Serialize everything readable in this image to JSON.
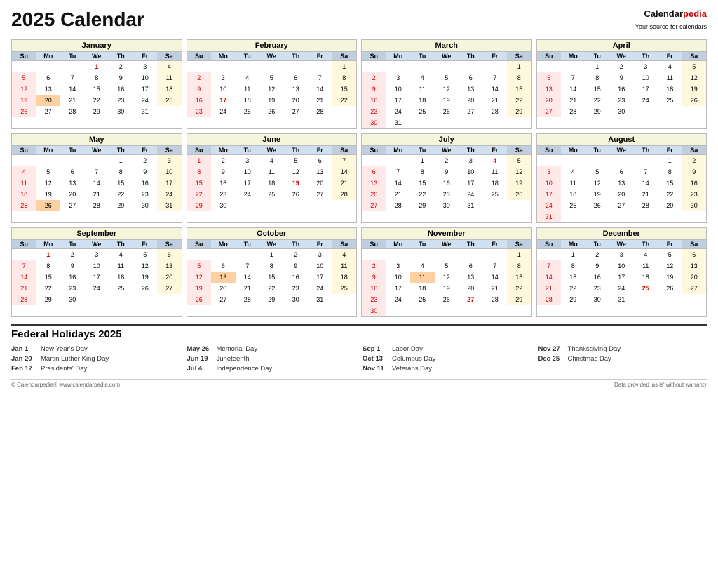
{
  "header": {
    "title": "2025 Calendar",
    "brand_name": "Calendar",
    "brand_suffix": "pedia",
    "brand_sub": "Your source for calendars"
  },
  "months": [
    {
      "name": "January",
      "days": [
        [
          "",
          "",
          "1",
          "2",
          "3",
          "4"
        ],
        [
          "5",
          "6",
          "7",
          "8",
          "9",
          "10",
          "11"
        ],
        [
          "12",
          "13",
          "14",
          "15",
          "16",
          "17",
          "18"
        ],
        [
          "19",
          "20",
          "21",
          "22",
          "23",
          "24",
          "25"
        ],
        [
          "26",
          "27",
          "28",
          "29",
          "30",
          "31",
          ""
        ]
      ],
      "holidays": {
        "1": "red",
        "20": "orange"
      }
    },
    {
      "name": "February",
      "days": [
        [
          "",
          "",
          "",
          "",
          "",
          "",
          "1"
        ],
        [
          "2",
          "3",
          "4",
          "5",
          "6",
          "7",
          "8"
        ],
        [
          "9",
          "10",
          "11",
          "12",
          "13",
          "14",
          "15"
        ],
        [
          "16",
          "17",
          "18",
          "19",
          "20",
          "21",
          "22"
        ],
        [
          "23",
          "24",
          "25",
          "26",
          "27",
          "28",
          ""
        ]
      ],
      "holidays": {
        "17": "red"
      }
    },
    {
      "name": "March",
      "days": [
        [
          "",
          "",
          "",
          "",
          "",
          "",
          "1"
        ],
        [
          "2",
          "3",
          "4",
          "5",
          "6",
          "7",
          "8"
        ],
        [
          "9",
          "10",
          "11",
          "12",
          "13",
          "14",
          "15"
        ],
        [
          "16",
          "17",
          "18",
          "19",
          "20",
          "21",
          "22"
        ],
        [
          "23",
          "24",
          "25",
          "26",
          "27",
          "28",
          "29"
        ],
        [
          "30",
          "31",
          "",
          "",
          "",
          "",
          ""
        ]
      ],
      "holidays": {}
    },
    {
      "name": "April",
      "days": [
        [
          "",
          "1",
          "2",
          "3",
          "4",
          "5"
        ],
        [
          "6",
          "7",
          "8",
          "9",
          "10",
          "11",
          "12"
        ],
        [
          "13",
          "14",
          "15",
          "16",
          "17",
          "18",
          "19"
        ],
        [
          "20",
          "21",
          "22",
          "23",
          "24",
          "25",
          "26"
        ],
        [
          "27",
          "28",
          "29",
          "30",
          "",
          "",
          ""
        ]
      ],
      "holidays": {}
    },
    {
      "name": "May",
      "days": [
        [
          "",
          "",
          "",
          "1",
          "2",
          "3"
        ],
        [
          "4",
          "5",
          "6",
          "7",
          "8",
          "9",
          "10"
        ],
        [
          "11",
          "12",
          "13",
          "14",
          "15",
          "16",
          "17"
        ],
        [
          "18",
          "19",
          "20",
          "21",
          "22",
          "23",
          "24"
        ],
        [
          "25",
          "26",
          "27",
          "28",
          "29",
          "30",
          "31"
        ]
      ],
      "holidays": {
        "26": "orange"
      }
    },
    {
      "name": "June",
      "days": [
        [
          "1",
          "2",
          "3",
          "4",
          "5",
          "6",
          "7"
        ],
        [
          "8",
          "9",
          "10",
          "11",
          "12",
          "13",
          "14"
        ],
        [
          "15",
          "16",
          "17",
          "18",
          "19",
          "20",
          "21"
        ],
        [
          "22",
          "23",
          "24",
          "25",
          "26",
          "27",
          "28"
        ],
        [
          "29",
          "30",
          "",
          "",
          "",
          "",
          ""
        ]
      ],
      "holidays": {
        "19": "red"
      }
    },
    {
      "name": "July",
      "days": [
        [
          "",
          "",
          "1",
          "2",
          "3",
          "4",
          "5"
        ],
        [
          "6",
          "7",
          "8",
          "9",
          "10",
          "11",
          "12"
        ],
        [
          "13",
          "14",
          "15",
          "16",
          "17",
          "18",
          "19"
        ],
        [
          "20",
          "21",
          "22",
          "23",
          "24",
          "25",
          "26"
        ],
        [
          "27",
          "28",
          "29",
          "30",
          "31",
          "",
          ""
        ]
      ],
      "holidays": {
        "4": "red"
      }
    },
    {
      "name": "August",
      "days": [
        [
          "",
          "",
          "",
          "",
          "",
          "1",
          "2"
        ],
        [
          "3",
          "4",
          "5",
          "6",
          "7",
          "8",
          "9"
        ],
        [
          "10",
          "11",
          "12",
          "13",
          "14",
          "15",
          "16"
        ],
        [
          "17",
          "18",
          "19",
          "20",
          "21",
          "22",
          "23"
        ],
        [
          "24",
          "25",
          "26",
          "27",
          "28",
          "29",
          "30"
        ],
        [
          "31",
          "",
          "",
          "",
          "",
          "",
          ""
        ]
      ],
      "holidays": {}
    },
    {
      "name": "September",
      "days": [
        [
          "",
          "1",
          "2",
          "3",
          "4",
          "5",
          "6"
        ],
        [
          "7",
          "8",
          "9",
          "10",
          "11",
          "12",
          "13"
        ],
        [
          "14",
          "15",
          "16",
          "17",
          "18",
          "19",
          "20"
        ],
        [
          "21",
          "22",
          "23",
          "24",
          "25",
          "26",
          "27"
        ],
        [
          "28",
          "29",
          "30",
          "",
          "",
          "",
          ""
        ]
      ],
      "holidays": {
        "1": "red"
      }
    },
    {
      "name": "October",
      "days": [
        [
          "",
          "",
          "1",
          "2",
          "3",
          "4"
        ],
        [
          "5",
          "6",
          "7",
          "8",
          "9",
          "10",
          "11"
        ],
        [
          "12",
          "13",
          "14",
          "15",
          "16",
          "17",
          "18"
        ],
        [
          "19",
          "20",
          "21",
          "22",
          "23",
          "24",
          "25"
        ],
        [
          "26",
          "27",
          "28",
          "29",
          "30",
          "31",
          ""
        ]
      ],
      "holidays": {
        "13": "orange"
      }
    },
    {
      "name": "November",
      "days": [
        [
          "",
          "",
          "",
          "",
          "",
          "",
          "1"
        ],
        [
          "2",
          "3",
          "4",
          "5",
          "6",
          "7",
          "8"
        ],
        [
          "9",
          "10",
          "11",
          "12",
          "13",
          "14",
          "15"
        ],
        [
          "16",
          "17",
          "18",
          "19",
          "20",
          "21",
          "22"
        ],
        [
          "23",
          "24",
          "25",
          "26",
          "27",
          "28",
          "29"
        ],
        [
          "30",
          "",
          "",
          "",
          "",
          "",
          ""
        ]
      ],
      "holidays": {
        "11": "orange",
        "27": "red"
      }
    },
    {
      "name": "December",
      "days": [
        [
          "",
          "1",
          "2",
          "3",
          "4",
          "5",
          "6"
        ],
        [
          "7",
          "8",
          "9",
          "10",
          "11",
          "12",
          "13"
        ],
        [
          "14",
          "15",
          "16",
          "17",
          "18",
          "19",
          "20"
        ],
        [
          "21",
          "22",
          "23",
          "24",
          "25",
          "26",
          "27"
        ],
        [
          "28",
          "29",
          "30",
          "31",
          "",
          "",
          ""
        ]
      ],
      "holidays": {
        "25": "red"
      }
    }
  ],
  "holidays_title": "Federal Holidays 2025",
  "holidays": [
    [
      {
        "date": "Jan 1",
        "name": "New Year's Day"
      },
      {
        "date": "Jan 20",
        "name": "Martin Luther King Day"
      },
      {
        "date": "Feb 17",
        "name": "Presidents' Day"
      }
    ],
    [
      {
        "date": "May 26",
        "name": "Memorial Day"
      },
      {
        "date": "Jun 19",
        "name": "Juneteenth"
      },
      {
        "date": "Jul 4",
        "name": "Independence Day"
      }
    ],
    [
      {
        "date": "Sep 1",
        "name": "Labor Day"
      },
      {
        "date": "Oct 13",
        "name": "Columbus Day"
      },
      {
        "date": "Nov 11",
        "name": "Veterans Day"
      }
    ],
    [
      {
        "date": "Nov 27",
        "name": "Thanksgiving Day"
      },
      {
        "date": "Dec 25",
        "name": "Christmas Day"
      }
    ]
  ],
  "footer_left": "© Calendarpedia®  www.calendarpedia.com",
  "footer_right": "Data provided 'as is' without warranty"
}
